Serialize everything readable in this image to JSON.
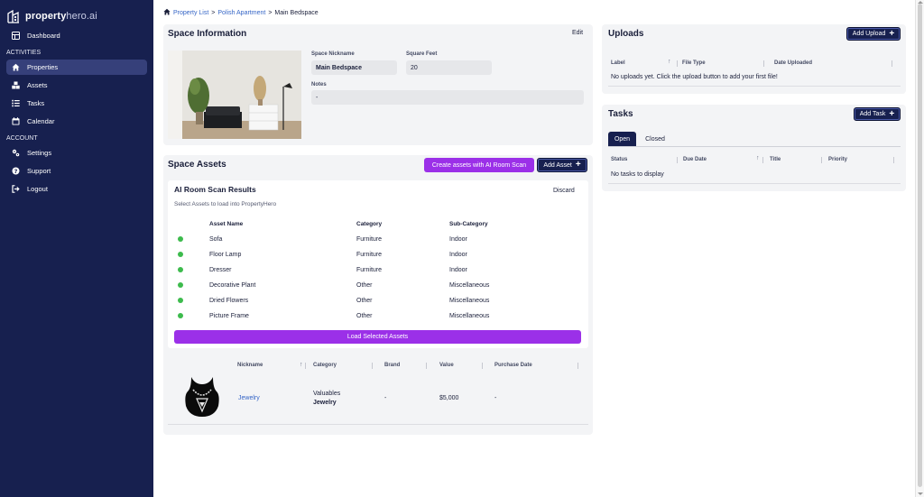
{
  "app": {
    "brand_bold": "property",
    "brand_light": "hero.ai"
  },
  "sidebar": {
    "dashboard": "Dashboard",
    "activities_label": "ACTIVITIES",
    "items": [
      {
        "label": "Properties",
        "icon": "home-icon",
        "active": true
      },
      {
        "label": "Assets",
        "icon": "assets-icon"
      },
      {
        "label": "Tasks",
        "icon": "tasks-icon"
      },
      {
        "label": "Calendar",
        "icon": "calendar-icon"
      }
    ],
    "account_label": "ACCOUNT",
    "account_items": [
      {
        "label": "Settings",
        "icon": "settings-icon"
      },
      {
        "label": "Support",
        "icon": "support-icon"
      },
      {
        "label": "Logout",
        "icon": "logout-icon"
      }
    ]
  },
  "breadcrumb": {
    "property_list": "Property List",
    "apartment": "Polish Apartment",
    "current": "Main Bedspace"
  },
  "space_info": {
    "title": "Space Information",
    "edit": "Edit",
    "nickname_label": "Space Nickname",
    "nickname_value": "Main Bedspace",
    "sqft_label": "Square Feet",
    "sqft_value": "20",
    "notes_label": "Notes",
    "notes_value": "-"
  },
  "space_assets": {
    "title": "Space Assets",
    "ai_scan_button": "Create assets with AI Room Scan",
    "add_asset_button": "Add Asset",
    "scan": {
      "title": "AI Room Scan Results",
      "discard": "Discard",
      "subtitle": "Select Assets to load into PropertyHero",
      "columns": [
        "Asset Name",
        "Category",
        "Sub-Category"
      ],
      "rows": [
        [
          "Sofa",
          "Furniture",
          "Indoor"
        ],
        [
          "Floor Lamp",
          "Furniture",
          "Indoor"
        ],
        [
          "Dresser",
          "Furniture",
          "Indoor"
        ],
        [
          "Decorative Plant",
          "Other",
          "Miscellaneous"
        ],
        [
          "Dried Flowers",
          "Other",
          "Miscellaneous"
        ],
        [
          "Picture Frame",
          "Other",
          "Miscellaneous"
        ]
      ],
      "load_button": "Load Selected Assets"
    },
    "table": {
      "columns": [
        "Nickname",
        "Category",
        "Brand",
        "Value",
        "Purchase Date"
      ],
      "row": {
        "nickname": "Jewelry",
        "category": "Valuables",
        "sub_category": "Jewelry",
        "brand": "-",
        "value": "$5,000",
        "purchase_date": "-"
      }
    }
  },
  "uploads": {
    "title": "Uploads",
    "add_button": "Add Upload",
    "columns": [
      "Label",
      "File Type",
      "Date Uploaded"
    ],
    "empty": "No uploads yet. Click the upload button to add your first file!"
  },
  "tasks": {
    "title": "Tasks",
    "add_button": "Add Task",
    "tabs": [
      "Open",
      "Closed"
    ],
    "columns": [
      "Status",
      "Due Date",
      "Title",
      "Priority"
    ],
    "empty": "No tasks to display"
  },
  "colors": {
    "sidebar": "#17204f",
    "accent_purple": "#9b30e8",
    "status_green": "#3dbb4d",
    "link_blue": "#3565c6"
  }
}
